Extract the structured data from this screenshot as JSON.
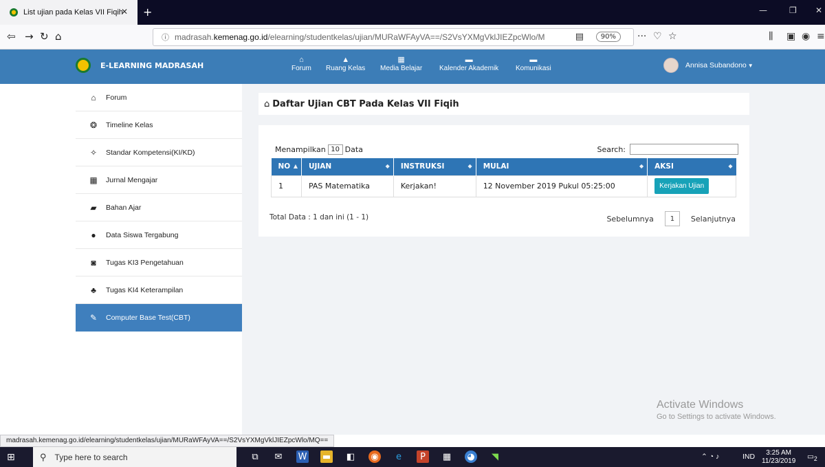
{
  "browser": {
    "tab_title": "List ujian pada Kelas VII Fiqih",
    "tab_close": "✕",
    "new_tab": "+",
    "url_domain_pre": "madrasah.",
    "url_domain_main": "kemenag.go.id",
    "url_path": "/elearning/studentkelas/ujian/MURaWFAyVA==/S2VsYXMgVklJIEZpcWlo/M",
    "zoom": "90%",
    "more": "···",
    "status_url": "madrasah.kemenag.go.id/elearning/studentkelas/ujian/MURaWFAyVA==/S2VsYXMgVklJIEZpcWlo/MQ=="
  },
  "header": {
    "brand": "E-LEARNING MADRASAH",
    "menu": [
      "Forum",
      "Ruang Kelas",
      "Media Belajar",
      "Kalender Akademik",
      "Komunikasi"
    ],
    "user": "Annisa Subandono"
  },
  "sidebar": {
    "items": [
      {
        "label": "Forum",
        "icon": "home-icon"
      },
      {
        "label": "Timeline Kelas",
        "icon": "timeline-icon"
      },
      {
        "label": "Standar Kompetensi(KI/KD)",
        "icon": "compass-icon"
      },
      {
        "label": "Jurnal Mengajar",
        "icon": "calendar-icon"
      },
      {
        "label": "Bahan Ajar",
        "icon": "folder-icon"
      },
      {
        "label": "Data Siswa Tergabung",
        "icon": "users-icon"
      },
      {
        "label": "Tugas KI3 Pengetahuan",
        "icon": "clipboard-icon"
      },
      {
        "label": "Tugas KI4 Keterampilan",
        "icon": "group-icon"
      },
      {
        "label": "Computer Base Test(CBT)",
        "icon": "edit-icon"
      }
    ]
  },
  "main": {
    "title": "Daftar Ujian CBT Pada Kelas VII Fiqih",
    "show_prefix": "Menampilkan",
    "show_value": "10",
    "show_suffix": "Data",
    "search_label": "Search:",
    "columns": [
      "NO",
      "UJIAN",
      "INSTRUKSI",
      "MULAI",
      "AKSI"
    ],
    "rows": [
      {
        "no": "1",
        "ujian": "PAS Matematika",
        "instruksi": "Kerjakan!",
        "mulai": "12 November 2019 Pukul 05:25:00",
        "aksi": "Kerjakan Ujian"
      }
    ],
    "total": "Total Data : 1 dan ini (1 - 1)",
    "prev": "Sebelumnya",
    "page": "1",
    "next": "Selanjutnya"
  },
  "watermark": {
    "line1": "Activate Windows",
    "line2": "Go to Settings to activate Windows."
  },
  "taskbar": {
    "search_placeholder": "Type here to search",
    "lang": "IND",
    "time": "3:25 AM",
    "date": "11/23/2019",
    "notif_count": "2"
  },
  "colors": {
    "header": "#3c7db7",
    "table_header": "#2e75b5",
    "active_sidebar": "#3f7fbd",
    "button": "#17a2b8"
  }
}
